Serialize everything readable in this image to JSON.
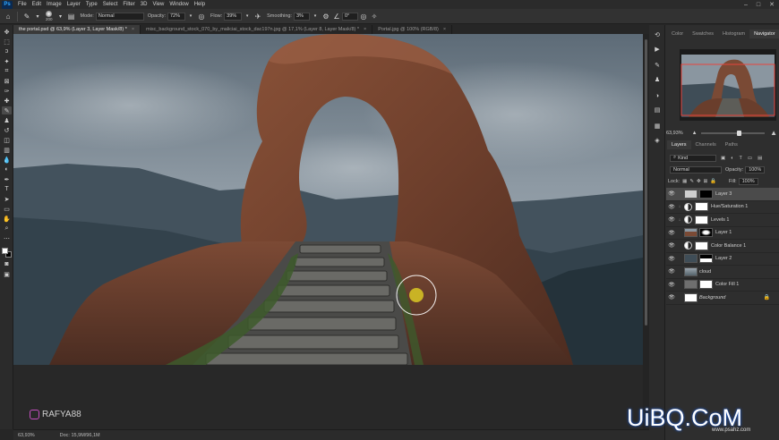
{
  "window": {
    "app_logo": "Ps",
    "menus": [
      "File",
      "Edit",
      "Image",
      "Layer",
      "Type",
      "Select",
      "Filter",
      "3D",
      "View",
      "Window",
      "Help"
    ],
    "controls": [
      "minimize-icon",
      "maximize-icon",
      "close-icon"
    ]
  },
  "options_bar": {
    "brush_size": "200",
    "mode_label": "Mode:",
    "mode_value": "Normal",
    "opacity_label": "Opacity:",
    "opacity_value": "72%",
    "flow_label": "Flow:",
    "flow_value": "39%",
    "smoothing_label": "Smoothing:",
    "smoothing_value": "3%",
    "angle_value": "0°"
  },
  "tabs": [
    {
      "label": "the portal.psd @ 63,9% (Layer 3, Layer Mask/8) *",
      "active": true
    },
    {
      "label": "misc_background_stock_070_by_maliciai_stock_dac197n.jpg @ 17,1% (Layer 8, Layer Mask/8) *",
      "active": false
    },
    {
      "label": "Portal.jpg @ 100% (RGB/8)",
      "active": false
    }
  ],
  "status": {
    "zoom": "63,93%",
    "doc": "Doc: 15,9M/96,1M"
  },
  "panels": {
    "top_tabs": [
      "Color",
      "Swatches",
      "Histogram",
      "Navigator"
    ],
    "active_top_tab": "Navigator",
    "navigator_zoom": "63,93%",
    "layer_tabs": [
      "Layers",
      "Channels",
      "Paths"
    ],
    "filter_kind": "Kind",
    "blend_mode": "Normal",
    "opacity_label": "Opacity:",
    "opacity_value": "100%",
    "lock_label": "Lock:",
    "fill_label": "Fill:",
    "fill_value": "100%"
  },
  "layers": [
    {
      "name": "Layer 3",
      "type": "pixel-mask",
      "selected": true
    },
    {
      "name": "Hue/Saturation 1",
      "type": "adjustment",
      "selected": false
    },
    {
      "name": "Levels 1",
      "type": "adjustment",
      "selected": false
    },
    {
      "name": "Layer 1",
      "type": "pixel-mask",
      "selected": false
    },
    {
      "name": "Color Balance 1",
      "type": "adjustment",
      "selected": false
    },
    {
      "name": "Layer 2",
      "type": "pixel-mask",
      "selected": false
    },
    {
      "name": "cloud",
      "type": "pixel",
      "selected": false
    },
    {
      "name": "Color Fill 1",
      "type": "fill",
      "selected": false
    },
    {
      "name": "Background",
      "type": "background",
      "selected": false
    }
  ],
  "watermarks": {
    "handle": "RAFYA88",
    "site": "UiBQ.CoM",
    "site_sub": "www.psahz.com"
  },
  "colors": {
    "accent": "#31a8ff",
    "brush_cursor": "#c9b325",
    "rock": "#7a4a35"
  }
}
